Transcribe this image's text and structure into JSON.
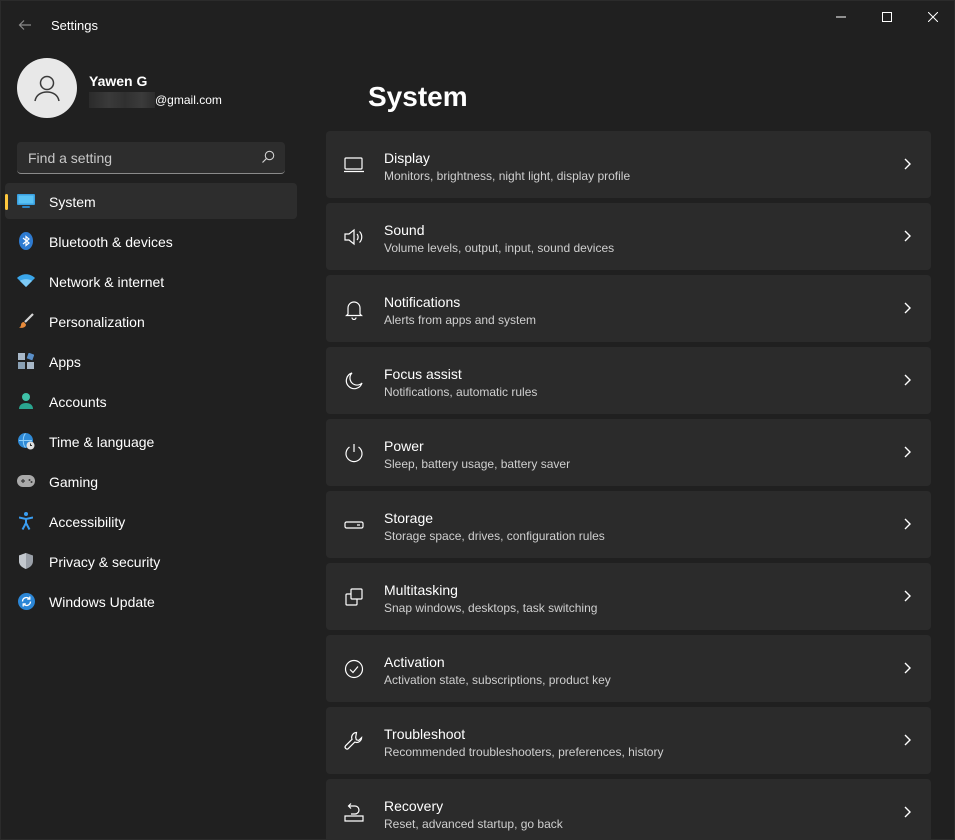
{
  "window": {
    "title": "Settings"
  },
  "profile": {
    "name": "Yawen G",
    "email_suffix": "@gmail.com"
  },
  "search": {
    "placeholder": "Find a setting"
  },
  "sidebar": {
    "items": [
      {
        "label": "System",
        "icon": "monitor-icon",
        "active": true
      },
      {
        "label": "Bluetooth & devices",
        "icon": "bluetooth-icon"
      },
      {
        "label": "Network & internet",
        "icon": "wifi-icon"
      },
      {
        "label": "Personalization",
        "icon": "brush-icon"
      },
      {
        "label": "Apps",
        "icon": "apps-icon"
      },
      {
        "label": "Accounts",
        "icon": "person-icon"
      },
      {
        "label": "Time & language",
        "icon": "globe-clock-icon"
      },
      {
        "label": "Gaming",
        "icon": "gamepad-icon"
      },
      {
        "label": "Accessibility",
        "icon": "accessibility-icon"
      },
      {
        "label": "Privacy & security",
        "icon": "shield-icon"
      },
      {
        "label": "Windows Update",
        "icon": "update-icon"
      }
    ]
  },
  "main": {
    "title": "System",
    "cards": [
      {
        "title": "Display",
        "desc": "Monitors, brightness, night light, display profile",
        "icon": "display-icon"
      },
      {
        "title": "Sound",
        "desc": "Volume levels, output, input, sound devices",
        "icon": "speaker-icon"
      },
      {
        "title": "Notifications",
        "desc": "Alerts from apps and system",
        "icon": "bell-icon"
      },
      {
        "title": "Focus assist",
        "desc": "Notifications, automatic rules",
        "icon": "moon-icon"
      },
      {
        "title": "Power",
        "desc": "Sleep, battery usage, battery saver",
        "icon": "power-icon"
      },
      {
        "title": "Storage",
        "desc": "Storage space, drives, configuration rules",
        "icon": "drive-icon"
      },
      {
        "title": "Multitasking",
        "desc": "Snap windows, desktops, task switching",
        "icon": "multitask-icon"
      },
      {
        "title": "Activation",
        "desc": "Activation state, subscriptions, product key",
        "icon": "check-circle-icon"
      },
      {
        "title": "Troubleshoot",
        "desc": "Recommended troubleshooters, preferences, history",
        "icon": "wrench-icon"
      },
      {
        "title": "Recovery",
        "desc": "Reset, advanced startup, go back",
        "icon": "recovery-icon"
      }
    ]
  },
  "colors": {
    "background": "#202020",
    "card": "#2b2b2b",
    "accent": "#ffc83d",
    "text": "#ffffff",
    "muted": "#cfcfcf"
  }
}
